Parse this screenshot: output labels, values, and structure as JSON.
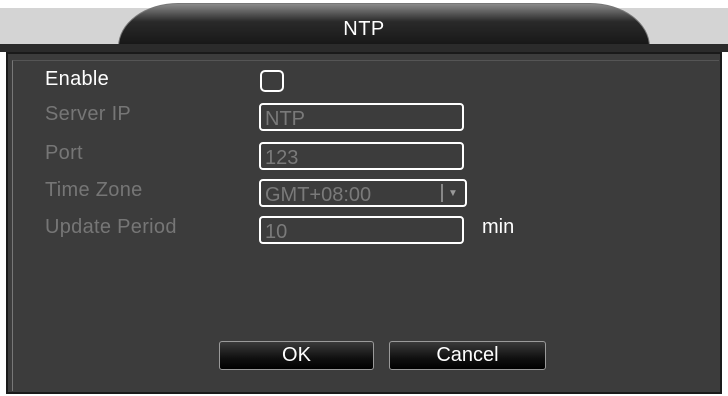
{
  "dialog": {
    "title": "NTP",
    "enable_label": "Enable",
    "enable_checked": false,
    "fields": [
      {
        "label": "Server IP",
        "value": "NTP"
      },
      {
        "label": "Port",
        "value": "123"
      },
      {
        "label": "Time Zone",
        "value": "GMT+08:00"
      },
      {
        "label": "Update Period",
        "value": "10"
      }
    ],
    "update_unit": "min",
    "ok_label": "OK",
    "cancel_label": "Cancel"
  },
  "colors": {
    "panel_bg": "#3c3c3c",
    "label_active": "#ffffff",
    "label_disabled": "#767676",
    "field_border": "#ffffff"
  },
  "icons": {
    "dropdown": "chevron-down-icon"
  }
}
